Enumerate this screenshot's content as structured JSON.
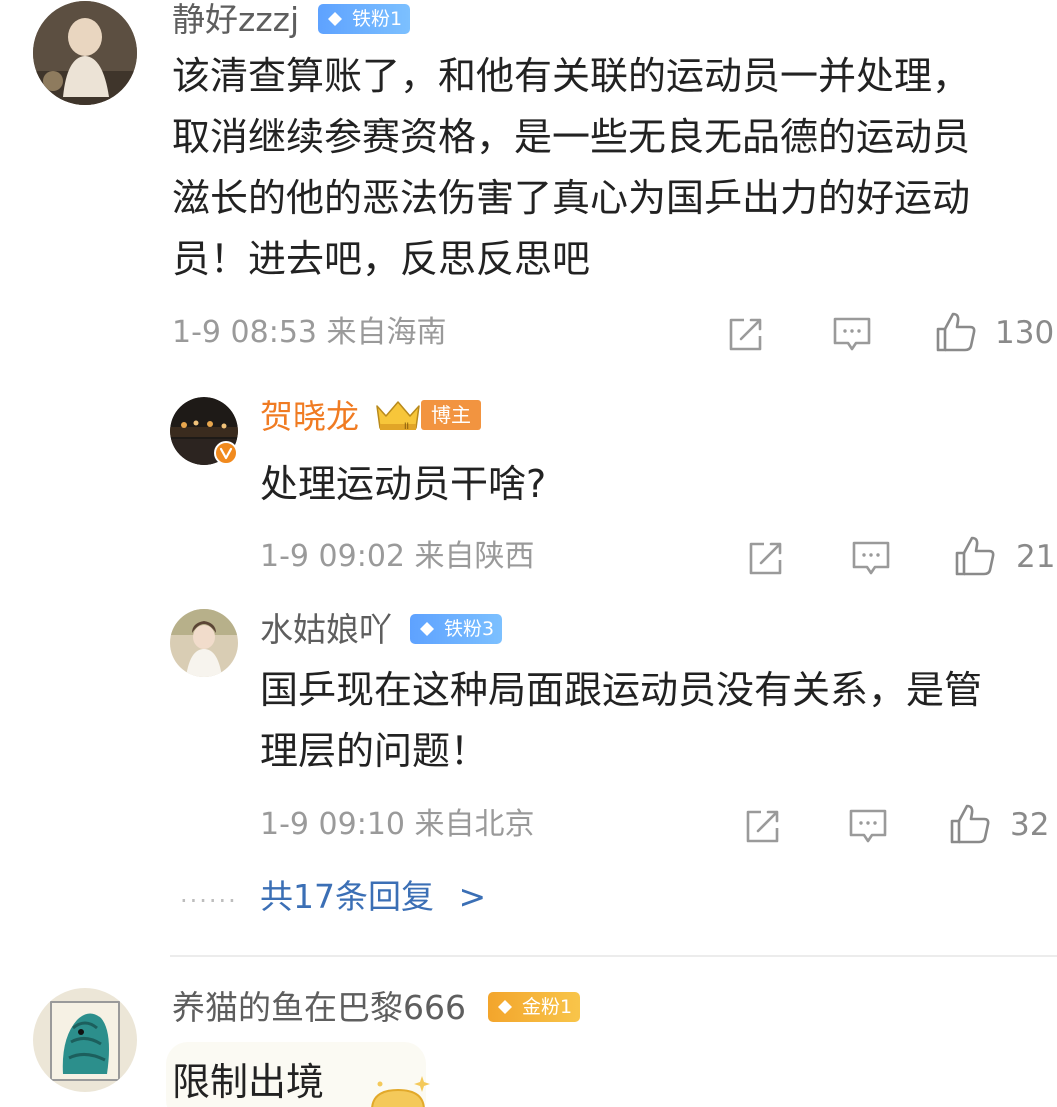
{
  "comments": [
    {
      "username": "静好zzzj",
      "badge": "铁粉1",
      "text": "该清查算账了，和他有关联的运动员一并处理，取消继续参赛资格，是一些无良无品德的运动员滋长的他的恶法伤害了真心为国乒出力的好运动员！进去吧，反思反思吧",
      "lines": [
        "该清查算账了，和他有关联的运动员一并处理，",
        "取消继续参赛资格，是一些无良无品德的运动员",
        "滋长的他的恶法伤害了真心为国乒出力的好运动",
        "员！进去吧，反思反思吧"
      ],
      "meta": "1-9 08:53 来自海南",
      "likes": "130"
    },
    {
      "username": "养猫的鱼在巴黎666",
      "badge": "金粉1",
      "text": "限制出境"
    }
  ],
  "replies": [
    {
      "username": "贺晓龙",
      "badge": "博主",
      "text": "处理运动员干啥?",
      "meta": "1-9 09:02 来自陕西",
      "likes": "21"
    },
    {
      "username": "水姑娘吖",
      "badge": "铁粉3",
      "text": "国乒现在这种局面跟运动员没有关系，是管理层的问题！",
      "lines": [
        "国乒现在这种局面跟运动员没有关系，是管",
        "理层的问题！"
      ],
      "meta": "1-9 09:10 来自北京",
      "likes": "32"
    }
  ],
  "more_replies": {
    "dots": "......",
    "label": "共17条回复",
    "chevron": ">"
  },
  "icons": {
    "repost": "share-icon",
    "comment": "comment-icon",
    "like": "thumbs-up-icon"
  },
  "colors": {
    "username": "#5e5e5e",
    "blogger_name": "#f07b22",
    "link": "#3b6fb5",
    "meta": "#9a9a9a",
    "fan_badge": "#6aafff",
    "gold_badge": "#f5b43a"
  }
}
